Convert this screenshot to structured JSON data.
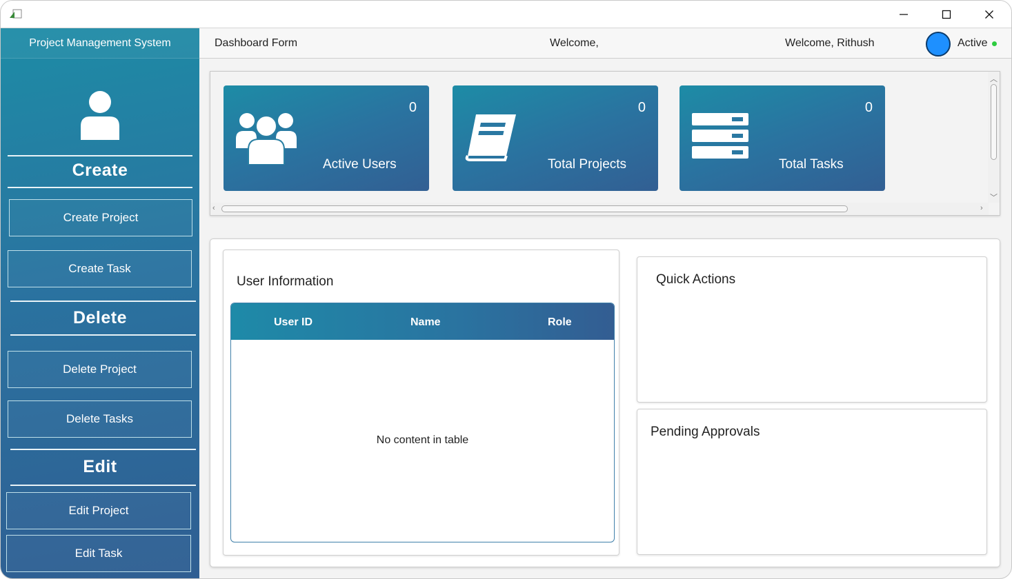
{
  "window": {
    "minimize": "—",
    "maximize": "☐",
    "close": "✕"
  },
  "sidebar": {
    "title": "Project Management System",
    "sections": {
      "create": "Create",
      "delete": "Delete",
      "edit": "Edit"
    },
    "buttons": {
      "create_project": "Create Project",
      "create_task": "Create Task",
      "delete_project": "Delete Project",
      "delete_tasks": "Delete Tasks",
      "edit_project": "Edit Project",
      "edit_task": "Edit Task"
    }
  },
  "header": {
    "form_title": "Dashboard Form",
    "welcome": "Welcome,",
    "welcome_user": "Welcome, Rithush",
    "status": "Active"
  },
  "cards": [
    {
      "count": "0",
      "label": "Active Users",
      "icon": "users-icon"
    },
    {
      "count": "0",
      "label": "Total Projects",
      "icon": "book-icon"
    },
    {
      "count": "0",
      "label": "Total Tasks",
      "icon": "server-icon"
    }
  ],
  "user_info": {
    "title": "User  Information",
    "columns": [
      "User ID",
      "Name",
      "Role"
    ],
    "empty_message": "No content in table"
  },
  "quick_actions": {
    "title": "Quick Actions"
  },
  "pending_approvals": {
    "title": "Pending Approvals"
  },
  "colors": {
    "accent": "#2a73a0",
    "accent_light": "#1d8ca6",
    "status_dot": "#2ecc40",
    "avatar": "#1e90ff"
  }
}
